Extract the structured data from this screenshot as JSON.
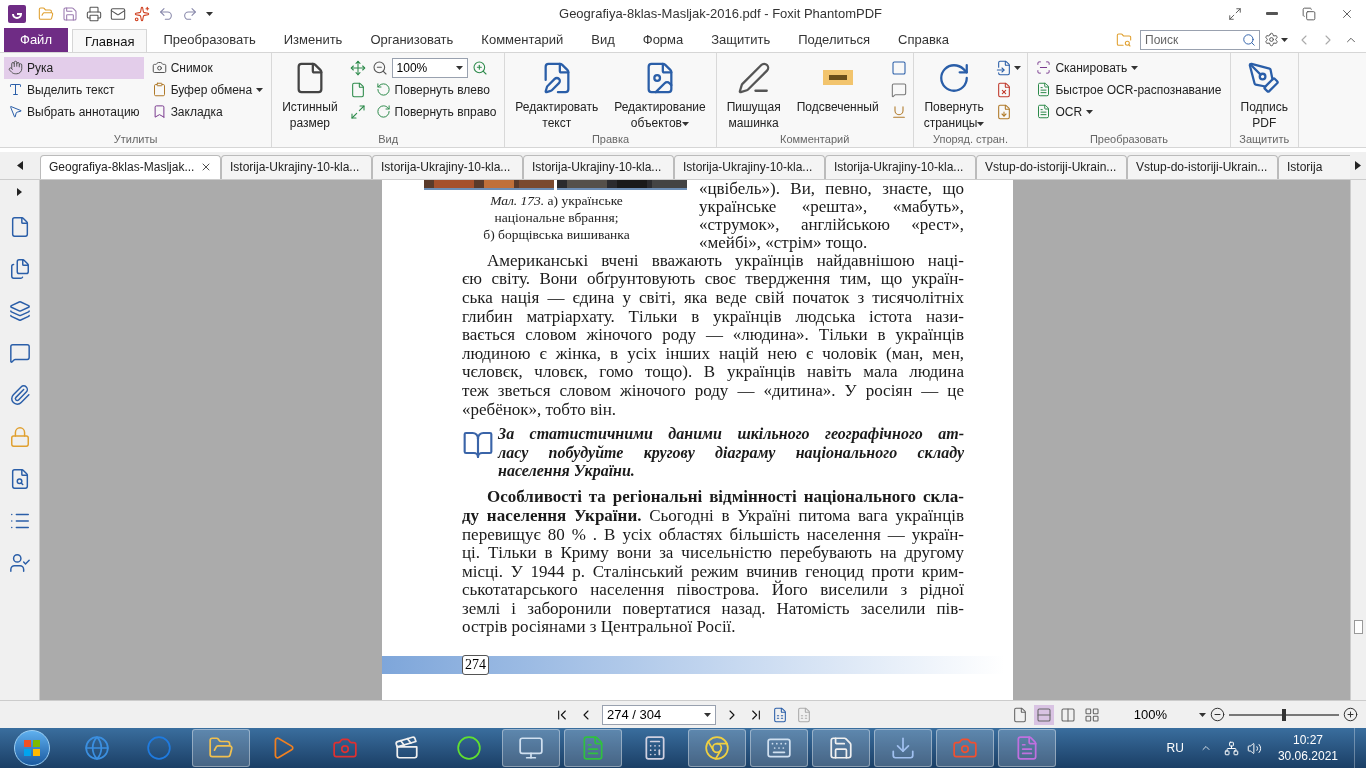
{
  "window": {
    "title": "Geografiya-8klas-Masljak-2016.pdf - Foxit PhantomPDF"
  },
  "menu_tabs": [
    {
      "label": "Файл",
      "kind": "file"
    },
    {
      "label": "Главная",
      "kind": "tab",
      "selected": true
    },
    {
      "label": "Преобразовать",
      "kind": "tab",
      "selected": false
    },
    {
      "label": "Изменить",
      "kind": "tab",
      "selected": false
    },
    {
      "label": "Организовать",
      "kind": "tab",
      "selected": false
    },
    {
      "label": "Комментарий",
      "kind": "tab",
      "selected": false
    },
    {
      "label": "Вид",
      "kind": "tab",
      "selected": false
    },
    {
      "label": "Форма",
      "kind": "tab",
      "selected": false
    },
    {
      "label": "Защитить",
      "kind": "tab",
      "selected": false
    },
    {
      "label": "Поделиться",
      "kind": "tab",
      "selected": false
    },
    {
      "label": "Справка",
      "kind": "tab",
      "selected": false
    }
  ],
  "search": {
    "placeholder": "Поиск"
  },
  "ribbon": [
    {
      "label": "Утилиты",
      "columns": [
        [
          {
            "kind": "small",
            "label": "Рука",
            "selected": true,
            "dropdown": false
          },
          {
            "kind": "small",
            "label": "Выделить текст",
            "selected": false,
            "dropdown": false
          },
          {
            "kind": "small",
            "label": "Выбрать аннотацию",
            "selected": false,
            "dropdown": false
          }
        ],
        [
          {
            "kind": "small",
            "label": "Снимок",
            "selected": false,
            "dropdown": false
          },
          {
            "kind": "small",
            "label": "Буфер обмена",
            "selected": false,
            "dropdown": true
          },
          {
            "kind": "small",
            "label": "Закладка",
            "selected": false,
            "dropdown": false
          }
        ]
      ]
    },
    {
      "label": "Вид",
      "columns": [
        [
          {
            "kind": "large",
            "label": "Истинный\nразмер",
            "dropdown": false
          }
        ],
        [
          {
            "kind": "icon",
            "dropdown": false
          },
          {
            "kind": "icon",
            "dropdown": false
          },
          {
            "kind": "icon",
            "dropdown": false
          }
        ],
        [
          {
            "kind": "zoom",
            "value": "100%"
          },
          {
            "kind": "small",
            "label": "Повернуть влево",
            "dropdown": false
          },
          {
            "kind": "small",
            "label": "Повернуть вправо",
            "dropdown": false
          }
        ]
      ]
    },
    {
      "label": "Правка",
      "columns": [
        [
          {
            "kind": "large",
            "label": "Редактировать\nтекст",
            "dropdown": false
          }
        ],
        [
          {
            "kind": "large",
            "label": "Редактирование\nобъектов",
            "dropdown": true
          }
        ]
      ]
    },
    {
      "label": "Комментарий",
      "columns": [
        [
          {
            "kind": "large",
            "label": "Пишущая\nмашинка",
            "dropdown": false
          }
        ],
        [
          {
            "kind": "large",
            "label": "Подсвеченный",
            "dropdown": false
          }
        ],
        [
          {
            "kind": "icon",
            "dropdown": false
          },
          {
            "kind": "icon",
            "dropdown": false
          },
          {
            "kind": "icon",
            "dropdown": false
          }
        ]
      ]
    },
    {
      "label": "Упоряд. стран.",
      "columns": [
        [
          {
            "kind": "large",
            "label": "Повернуть\nстраницы",
            "dropdown": true
          }
        ],
        [
          {
            "kind": "icon",
            "dropdown": true
          },
          {
            "kind": "icon",
            "dropdown": false
          },
          {
            "kind": "icon",
            "dropdown": false
          }
        ]
      ]
    },
    {
      "label": "Преобразовать",
      "columns": [
        [
          {
            "kind": "small",
            "label": "Сканировать",
            "dropdown": true
          },
          {
            "kind": "small",
            "label": "Быстрое OCR-распознавание",
            "dropdown": false
          },
          {
            "kind": "small",
            "label": "OCR",
            "dropdown": true
          }
        ]
      ]
    },
    {
      "label": "Защитить",
      "columns": [
        [
          {
            "kind": "large",
            "label": "Подпись\nPDF",
            "dropdown": false
          }
        ]
      ]
    }
  ],
  "doc_tabs": [
    {
      "label": "Geografiya-8klas-Masljak...",
      "selected": true
    },
    {
      "label": "Istorija-Ukrajiny-10-kla...",
      "selected": false
    },
    {
      "label": "Istorija-Ukrajiny-10-kla...",
      "selected": false
    },
    {
      "label": "Istorija-Ukrajiny-10-kla...",
      "selected": false
    },
    {
      "label": "Istorija-Ukrajiny-10-kla...",
      "selected": false
    },
    {
      "label": "Istorija-Ukrajiny-10-kla...",
      "selected": false
    },
    {
      "label": "Vstup-do-istoriji-Ukrain...",
      "selected": false
    },
    {
      "label": "Vstup-do-istoriji-Ukrain...",
      "selected": false
    },
    {
      "label": "Istorija",
      "selected": false
    }
  ],
  "document": {
    "figure_caption": [
      "*Мал. 173.* а) українське",
      "національне вбрання;",
      "б) борщівська вишиванка"
    ],
    "side_text": [
      "«цвібель»). Ви, певно, знаєте, що",
      "українське «решта», «мабуть»,",
      "«струмок», англійською «рест»,",
      "«мейбі», «стрім» тощо."
    ],
    "paragraphs": [
      {
        "kind": "text",
        "lines": [
          "Американські вчені вважають українців найдавнішою наці-",
          "єю світу. Вони обґрунтовують своє твердження тим, що україн-",
          "ська нація — єдина у світі, яка веде свій початок з тисячолітніх",
          "глибин матріархату. Тільки в українців людська істота нази-",
          "вається словом жіночого роду — «людина». Тільки в українців",
          "людиною є жінка, в усіх інших націй нею є чоловік (ман, мен,",
          "чєловєк, чловєк, гомо тощо). В українців навіть мала людина",
          "теж зветься словом жіночого роду — «дитина». У росіян — це",
          "«ребёнок», тобто він."
        ]
      },
      {
        "kind": "task",
        "lines": [
          "За статистичними даними шкільного географічного ат-",
          "ласу побудуйте кругову діаграму національного складу",
          "населення України."
        ]
      },
      {
        "kind": "text",
        "lines": [
          "**Особливості та регіональні відмінності національного скла-**",
          "**ду населення України.** Сьогодні в Україні питома вага українців",
          "перевищує 80 % . В усіх областях більшість населення — україн-",
          "ці. Тільки в Криму вони за чисельністю перебувають на другому",
          "місці. У 1944 р. Сталінський режим вчинив геноцид проти крим-",
          "ськотатарського населення півострова. Його виселили з рідної",
          "землі і заборонили повертатися назад. Натомість заселили пів-",
          "острів росіянами з Центральної Росії."
        ]
      }
    ],
    "page_number": "274"
  },
  "navigation": {
    "page": "274 / 304",
    "view_modes": [
      {
        "selected": false
      },
      {
        "selected": true
      },
      {
        "selected": false
      },
      {
        "selected": false
      }
    ],
    "zoom": "100%",
    "zoom_slider": {
      "level": 0.5
    }
  },
  "taskbar": {
    "apps": [
      {
        "running": false
      },
      {
        "running": false
      },
      {
        "running": true
      },
      {
        "running": false
      },
      {
        "running": false
      },
      {
        "running": false
      },
      {
        "running": false
      },
      {
        "running": true
      },
      {
        "running": true
      },
      {
        "running": false
      },
      {
        "running": true
      },
      {
        "running": true
      },
      {
        "running": true
      },
      {
        "running": true
      },
      {
        "running": true
      },
      {
        "running": true
      }
    ],
    "language": "RU",
    "time": "10:27",
    "date": "30.06.2021"
  }
}
